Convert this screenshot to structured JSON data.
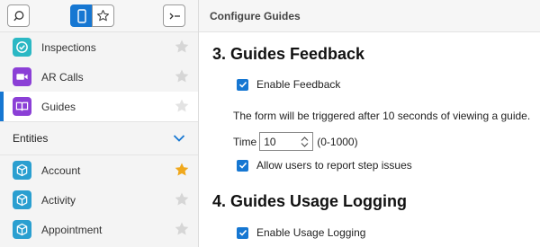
{
  "sidebar": {
    "items": [
      {
        "label": "Inspections",
        "icon": "clipboard-check-icon",
        "color": "#2bb8c4",
        "starred": false
      },
      {
        "label": "AR Calls",
        "icon": "video-camera-icon",
        "color": "#8b3fd6",
        "starred": false
      },
      {
        "label": "Guides",
        "icon": "book-icon",
        "color": "#8b3fd6",
        "starred": false,
        "active": true
      }
    ],
    "group": {
      "label": "Entities",
      "expanded": true
    },
    "entities": [
      {
        "label": "Account",
        "icon": "cube-icon",
        "color": "#2a9fd0",
        "starred": true
      },
      {
        "label": "Activity",
        "icon": "cube-icon",
        "color": "#2a9fd0",
        "starred": false
      },
      {
        "label": "Appointment",
        "icon": "cube-icon",
        "color": "#2a9fd0",
        "starred": false
      }
    ]
  },
  "main": {
    "header_title": "Configure Guides",
    "feedback": {
      "title": "3. Guides Feedback",
      "enable_label": "Enable Feedback",
      "enable_checked": true,
      "description": "The form will be triggered after 10 seconds of viewing a guide.",
      "time_label": "Time",
      "time_value": "10",
      "time_range": "(0-1000)",
      "report_label": "Allow users to report step issues",
      "report_checked": true
    },
    "usage": {
      "title": "4. Guides Usage Logging",
      "enable_label": "Enable Usage Logging",
      "enable_checked": true
    }
  },
  "colors": {
    "accent": "#1677d2",
    "star_active": "#f0a81c",
    "star_inactive": "#d6d6d6"
  }
}
